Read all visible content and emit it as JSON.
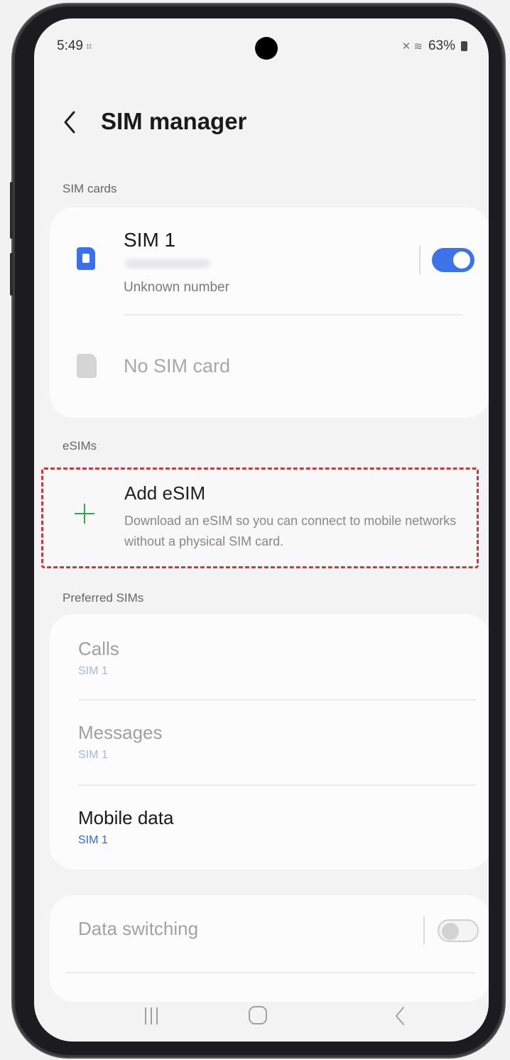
{
  "status_bar": {
    "time": "5:49",
    "left_icon": "⌗",
    "right_icons": "✕ ≋",
    "battery": "63%"
  },
  "header": {
    "title": "SIM manager"
  },
  "sim_cards": {
    "section_label": "SIM cards",
    "sim1": {
      "name": "SIM 1",
      "subtitle": "Unknown number",
      "enabled": true
    },
    "sim2": {
      "label": "No SIM card"
    }
  },
  "esims": {
    "section_label": "eSIMs",
    "add": {
      "title": "Add eSIM",
      "description": "Download an eSIM so you can connect to mobile networks without a physical SIM card."
    }
  },
  "preferred": {
    "section_label": "Preferred SIMs",
    "items": [
      {
        "title": "Calls",
        "value": "SIM 1"
      },
      {
        "title": "Messages",
        "value": "SIM 1"
      },
      {
        "title": "Mobile data",
        "value": "SIM 1"
      }
    ]
  },
  "data_switching": {
    "label": "Data switching",
    "enabled": false
  },
  "colors": {
    "accent": "#3b73e8",
    "highlight_border": "#c93a42",
    "plus": "#32a852"
  },
  "icons": [
    "back-chevron-icon",
    "sim-card-icon",
    "plus-icon",
    "recent-apps-icon",
    "home-icon",
    "back-icon"
  ]
}
